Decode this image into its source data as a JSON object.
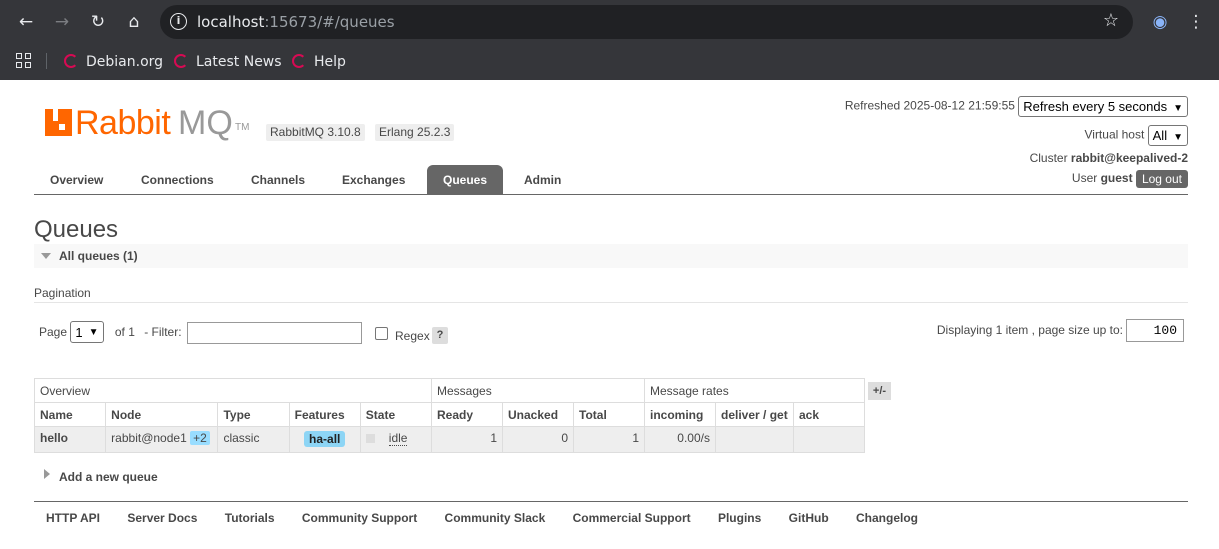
{
  "browser": {
    "url_host": "localhost",
    "url_rest": ":15673/#/queues",
    "bookmarks": [
      "Debian.org",
      "Latest News",
      "Help"
    ]
  },
  "header": {
    "logo_rabbit": "Rabbit",
    "logo_mq": "MQ",
    "logo_tm": "TM",
    "version": "RabbitMQ 3.10.8",
    "erlang": "Erlang 25.2.3",
    "refreshed": "Refreshed 2025-08-12 21:59:55",
    "refresh_select": "Refresh every 5 seconds",
    "vhost_label": "Virtual host",
    "vhost_select": "All",
    "cluster_label": "Cluster",
    "cluster_name": "rabbit@keepalived-2",
    "user_label": "User",
    "user_name": "guest",
    "logout": "Log out"
  },
  "tabs": [
    "Overview",
    "Connections",
    "Channels",
    "Exchanges",
    "Queues",
    "Admin"
  ],
  "page": {
    "title": "Queues",
    "section": "All queues (1)",
    "pagination_label": "Pagination",
    "page_label": "Page",
    "page_value": "1",
    "of_label": "of 1",
    "filter_label": "- Filter:",
    "regex_label": "Regex",
    "help": "?",
    "display_label": "Displaying 1 item , page size up to:",
    "page_size": "100",
    "plus_minus": "+/-",
    "add_queue": "Add a new queue"
  },
  "table": {
    "groups": [
      "Overview",
      "Messages",
      "Message rates"
    ],
    "columns": [
      "Name",
      "Node",
      "Type",
      "Features",
      "State",
      "Ready",
      "Unacked",
      "Total",
      "incoming",
      "deliver / get",
      "ack"
    ],
    "rows": [
      {
        "name": "hello",
        "node": "rabbit@node1",
        "node_extra": "+2",
        "type": "classic",
        "feature": "ha-all",
        "state": "idle",
        "ready": "1",
        "unacked": "0",
        "total": "1",
        "incoming": "0.00/s",
        "deliver": "",
        "ack": ""
      }
    ]
  },
  "footer": [
    "HTTP API",
    "Server Docs",
    "Tutorials",
    "Community Support",
    "Community Slack",
    "Commercial Support",
    "Plugins",
    "GitHub",
    "Changelog"
  ]
}
